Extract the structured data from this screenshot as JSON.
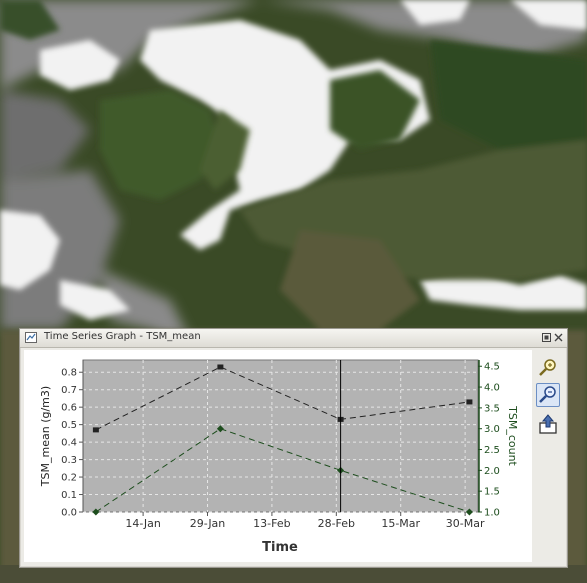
{
  "window": {
    "title": "Time Series Graph - TSM_mean"
  },
  "toolbar": {
    "tools": [
      "zoom-in-icon",
      "zoom-out-icon",
      "export-icon"
    ]
  },
  "colors": {
    "plot_bg": "#b3b3b3",
    "series_mean": "#222222",
    "series_count": "#1d4d1d",
    "cursor": "#000000"
  },
  "chart_data": {
    "type": "line",
    "xlabel": "Time",
    "x_ticks": [
      "14-Jan",
      "29-Jan",
      "13-Feb",
      "28-Feb",
      "15-Mar",
      "30-Mar"
    ],
    "xlim": [
      "2002-12-31",
      "2003-04-02"
    ],
    "y_left": {
      "label": "TSM_mean (g/m3)",
      "ylim": [
        0.0,
        0.87
      ],
      "ticks": [
        "0.0",
        "0.1",
        "0.2",
        "0.3",
        "0.4",
        "0.5",
        "0.6",
        "0.7",
        "0.8"
      ]
    },
    "y_right": {
      "label": "TSM_count",
      "ylim": [
        1.0,
        4.65
      ],
      "ticks": [
        "1.0",
        "1.5",
        "2.0",
        "2.5",
        "3.0",
        "3.5",
        "4.0",
        "4.5"
      ]
    },
    "series": [
      {
        "axis": "left",
        "marker": "square",
        "x": [
          "2003-01-03",
          "2003-02-01",
          "2003-03-01",
          "2003-03-31"
        ],
        "values": [
          0.47,
          0.83,
          0.53,
          0.63
        ]
      },
      {
        "axis": "right",
        "marker": "diamond",
        "x": [
          "2003-01-03",
          "2003-02-01",
          "2003-03-01",
          "2003-03-31"
        ],
        "values": [
          1.0,
          3.0,
          2.0,
          1.0
        ]
      }
    ],
    "cursor_x": "2003-03-01",
    "grid": true,
    "line_style": "dashed"
  }
}
